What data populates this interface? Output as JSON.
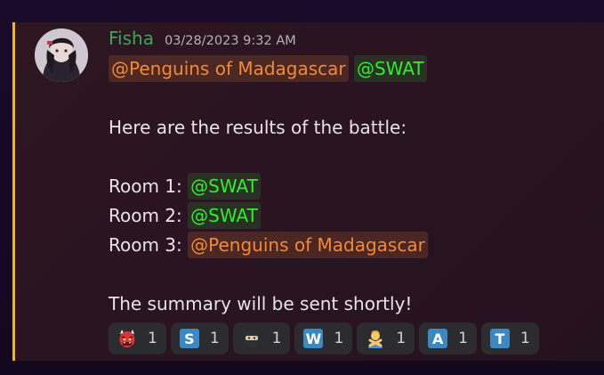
{
  "message": {
    "author": "Fisha",
    "timestamp": "03/28/2023 9:32 AM",
    "mention_penguins": "@Penguins of Madagascar",
    "mention_swat": "@SWAT",
    "intro": "Here are the results of the battle:",
    "rooms": [
      {
        "label": "Room 1:",
        "winner": "@SWAT"
      },
      {
        "label": "Room 2:",
        "winner": "@SWAT"
      },
      {
        "label": "Room 3:",
        "winner": "@Penguins of Madagascar"
      }
    ],
    "summary": "The summary will be sent shortly!"
  },
  "reactions": [
    {
      "icon": "ogre-mask-icon",
      "count": "1"
    },
    {
      "icon": "regional-s-icon",
      "letter": "S",
      "count": "1"
    },
    {
      "icon": "ninja-icon",
      "count": "1"
    },
    {
      "icon": "regional-w-icon",
      "letter": "W",
      "count": "1"
    },
    {
      "icon": "person-gesturing-no-icon",
      "count": "1"
    },
    {
      "icon": "regional-a-icon",
      "letter": "A",
      "count": "1"
    },
    {
      "icon": "regional-t-icon",
      "letter": "T",
      "count": "1"
    }
  ],
  "colors": {
    "author": "#3ba55c",
    "mention_role_orange": "#f28a35",
    "mention_role_green": "#2cf02c",
    "highlight_bar": "#f0b232"
  }
}
